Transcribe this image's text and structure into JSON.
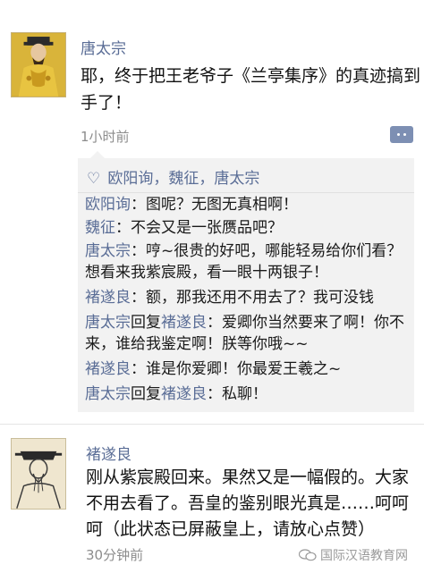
{
  "post1": {
    "author": "唐太宗",
    "text_line1": "耶，终于把王老爷子《兰亭集序》的真迹搞到",
    "text_line2": "手了！",
    "time": "1小时前"
  },
  "likes": {
    "icon": "heart-outline-icon",
    "names": "欧阳询，魏征，唐太宗"
  },
  "comments": [
    {
      "name": "欧阳询",
      "text": "：图呢？无图无真相啊！"
    },
    {
      "name": "魏征",
      "text": "：不会又是一张赝品吧？"
    },
    {
      "name": "唐太宗",
      "text": "：哼~很贵的好吧，哪能轻易给你们看？想看来我紫宸殿，看一眼十两银子！"
    },
    {
      "name": "褚遂良",
      "text": "：额，那我还用不用去了？我可没钱"
    },
    {
      "name": "唐太宗",
      "reply_word": "回复",
      "reply_to": "褚遂良",
      "text": "：爱卿你当然要来了啊！你不来，谁给我鉴定啊！朕等你哦~~"
    },
    {
      "name": "褚遂良",
      "text": "：谁是你爱卿！你最爱王羲之~"
    },
    {
      "name": "唐太宗",
      "reply_word": "回复",
      "reply_to": "褚遂良",
      "text": "：私聊！"
    }
  ],
  "post2": {
    "author": "褚遂良",
    "text_line1": "刚从紫宸殿回来。果然又是一幅假的。大家",
    "text_line2": "不用去看了。吾皇的鉴别眼光真是……呵呵",
    "text_line3": "呵（此状态已屏蔽皇上，请放心点赞）",
    "time": "30分钟前"
  },
  "watermark": {
    "text": "国际汉语教育网"
  },
  "colors": {
    "name": "#5a6d96",
    "comment_bg": "#f2f2f2",
    "time": "#8c8c8c"
  }
}
